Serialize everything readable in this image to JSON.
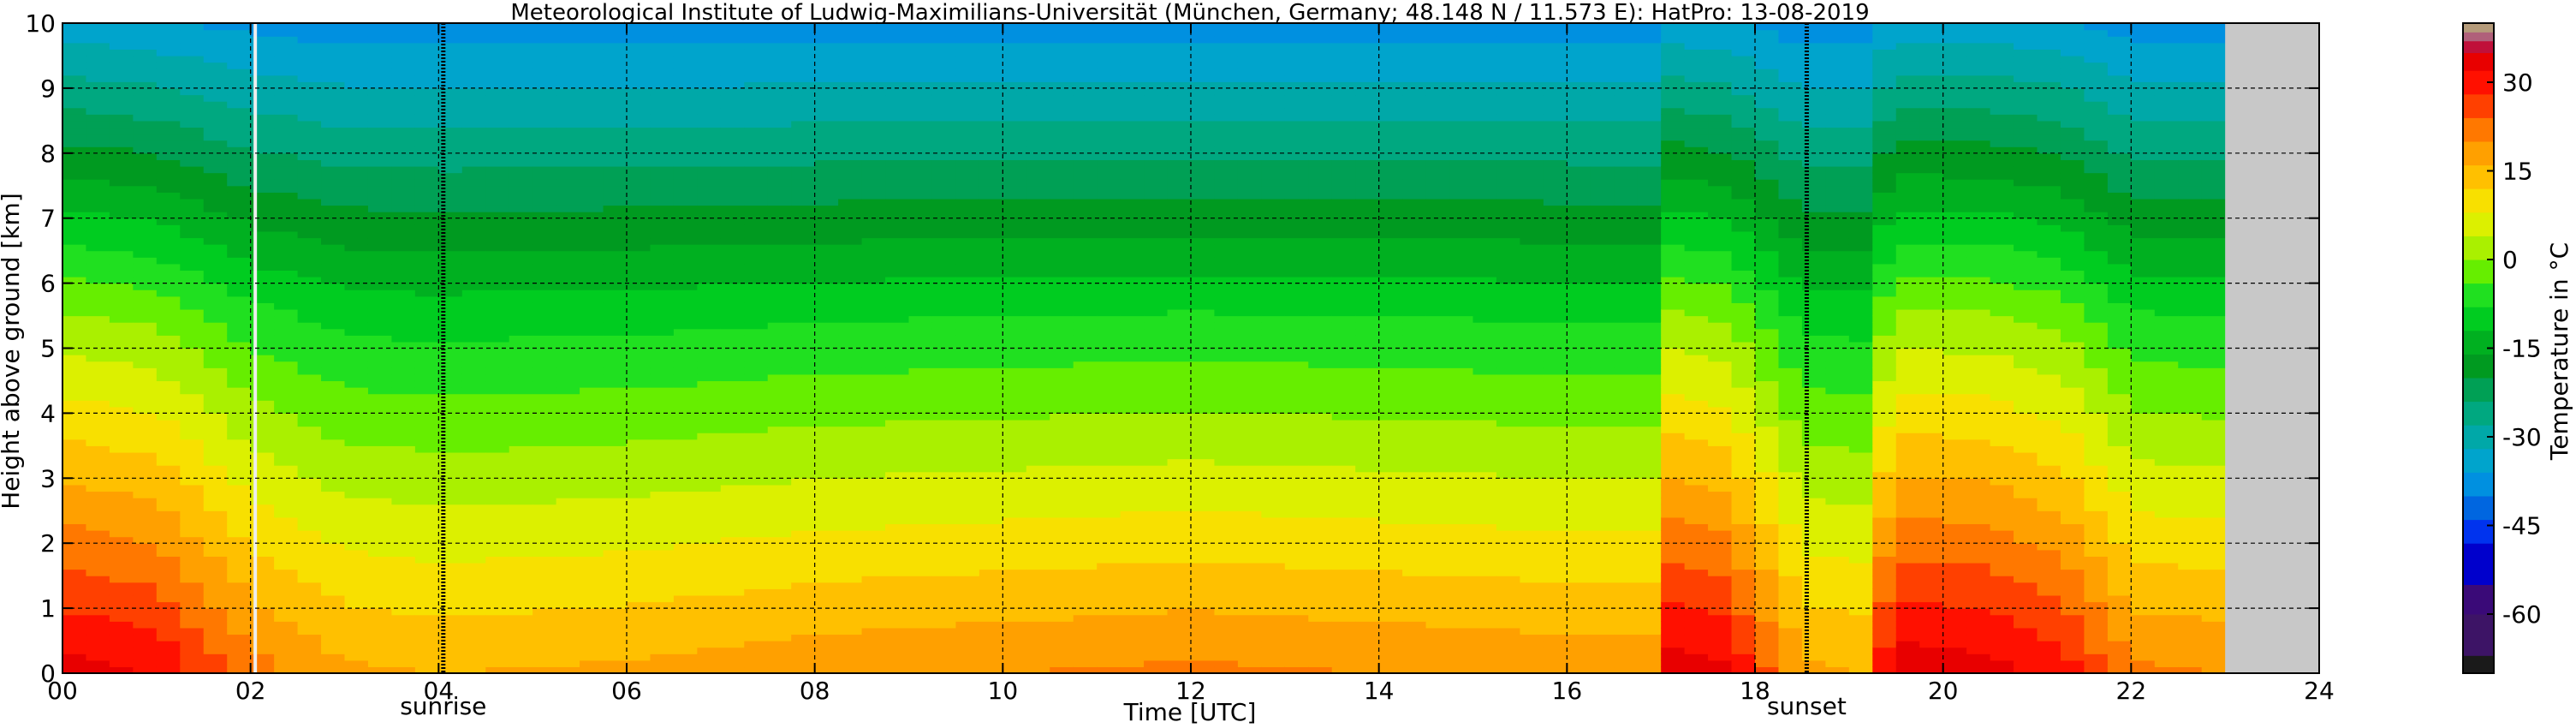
{
  "chart_data": {
    "type": "heatmap",
    "title": "Meteorological Institute of Ludwig-Maximilians-Universität (München, Germany; 48.148 N / 11.573 E):    HatPro: 13-08-2019",
    "xlabel": "Time [UTC]",
    "ylabel": "Height above ground [km]",
    "xlim": [
      0,
      24
    ],
    "ylim": [
      0,
      10
    ],
    "x_ticks": [
      {
        "value": 0,
        "label": "00"
      },
      {
        "value": 2,
        "label": "02"
      },
      {
        "value": 4,
        "label": "04"
      },
      {
        "value": 6,
        "label": "06"
      },
      {
        "value": 8,
        "label": "08"
      },
      {
        "value": 10,
        "label": "10"
      },
      {
        "value": 12,
        "label": "12"
      },
      {
        "value": 14,
        "label": "14"
      },
      {
        "value": 16,
        "label": "16"
      },
      {
        "value": 18,
        "label": "18"
      },
      {
        "value": 20,
        "label": "20"
      },
      {
        "value": 22,
        "label": "22"
      },
      {
        "value": 24,
        "label": "24"
      }
    ],
    "y_ticks": [
      {
        "value": 0,
        "label": "0"
      },
      {
        "value": 1,
        "label": "1"
      },
      {
        "value": 2,
        "label": "2"
      },
      {
        "value": 3,
        "label": "3"
      },
      {
        "value": 4,
        "label": "4"
      },
      {
        "value": 5,
        "label": "5"
      },
      {
        "value": 6,
        "label": "6"
      },
      {
        "value": 7,
        "label": "7"
      },
      {
        "value": 8,
        "label": "8"
      },
      {
        "value": 9,
        "label": "9"
      },
      {
        "value": 10,
        "label": "10"
      }
    ],
    "grid": true,
    "data_end_time": 23.0,
    "markers": [
      {
        "label": "sunrise",
        "x": 4.05
      },
      {
        "label": "sunset",
        "x": 18.55
      }
    ],
    "missing_data_gaps": [
      2.05
    ],
    "profile_times": [
      0.0,
      1.0,
      2.0,
      3.0,
      4.0,
      6.0,
      8.0,
      10.0,
      12.0,
      14.0,
      16.0,
      16.9,
      17.0,
      17.7,
      18.5,
      19.3,
      19.4,
      20.5,
      21.3,
      22.0,
      23.0
    ],
    "profiles": [
      {
        "t": 0.0,
        "t_sfc": 34,
        "lapse": 6.1
      },
      {
        "t": 1.0,
        "t_sfc": 32,
        "lapse": 6.0
      },
      {
        "t": 2.0,
        "t_sfc": 22,
        "lapse": 5.2
      },
      {
        "t": 3.0,
        "t_sfc": 17,
        "lapse": 4.8
      },
      {
        "t": 4.0,
        "t_sfc": 16,
        "lapse": 4.7
      },
      {
        "t": 6.0,
        "t_sfc": 17,
        "lapse": 4.8
      },
      {
        "t": 8.0,
        "t_sfc": 19,
        "lapse": 5.0
      },
      {
        "t": 10.0,
        "t_sfc": 20,
        "lapse": 5.1
      },
      {
        "t": 12.0,
        "t_sfc": 21,
        "lapse": 5.2
      },
      {
        "t": 14.0,
        "t_sfc": 20,
        "lapse": 5.1
      },
      {
        "t": 16.0,
        "t_sfc": 19,
        "lapse": 5.0
      },
      {
        "t": 16.9,
        "t_sfc": 19,
        "lapse": 5.0
      },
      {
        "t": 17.0,
        "t_sfc": 35,
        "lapse": 6.2
      },
      {
        "t": 17.7,
        "t_sfc": 33,
        "lapse": 6.1
      },
      {
        "t": 18.5,
        "t_sfc": 17,
        "lapse": 4.8
      },
      {
        "t": 19.3,
        "t_sfc": 16,
        "lapse": 4.7
      },
      {
        "t": 19.4,
        "t_sfc": 35,
        "lapse": 6.2
      },
      {
        "t": 20.5,
        "t_sfc": 34,
        "lapse": 6.1
      },
      {
        "t": 21.3,
        "t_sfc": 30,
        "lapse": 5.8
      },
      {
        "t": 22.0,
        "t_sfc": 21,
        "lapse": 5.2
      },
      {
        "t": 23.0,
        "t_sfc": 20,
        "lapse": 5.1
      }
    ],
    "colorbar": {
      "label": "Temperature in °C",
      "range": [
        -70,
        40
      ],
      "tick_labels": [
        {
          "value": 30,
          "label": "30"
        },
        {
          "value": 15,
          "label": "15"
        },
        {
          "value": 0,
          "label": "0"
        },
        {
          "value": -15,
          "label": "-15"
        },
        {
          "value": -30,
          "label": "-30"
        },
        {
          "value": -45,
          "label": "-45"
        },
        {
          "value": -60,
          "label": "-60"
        }
      ],
      "colors": [
        {
          "from": -70,
          "to": -67,
          "color": "#1a1a1a"
        },
        {
          "from": -67,
          "to": -60,
          "color": "#3d1466"
        },
        {
          "from": -60,
          "to": -55,
          "color": "#3a0a78"
        },
        {
          "from": -55,
          "to": -48,
          "color": "#0000cc"
        },
        {
          "from": -48,
          "to": -44,
          "color": "#0033ee"
        },
        {
          "from": -44,
          "to": -40,
          "color": "#0066e0"
        },
        {
          "from": -40,
          "to": -36,
          "color": "#0090e0"
        },
        {
          "from": -36,
          "to": -32,
          "color": "#00a4cc"
        },
        {
          "from": -32,
          "to": -28,
          "color": "#00a8a8"
        },
        {
          "from": -28,
          "to": -24,
          "color": "#00a880"
        },
        {
          "from": -24,
          "to": -20,
          "color": "#00a055"
        },
        {
          "from": -20,
          "to": -16,
          "color": "#009a20"
        },
        {
          "from": -16,
          "to": -12,
          "color": "#00b020"
        },
        {
          "from": -12,
          "to": -8,
          "color": "#00cc20"
        },
        {
          "from": -8,
          "to": -4,
          "color": "#20e020"
        },
        {
          "from": -4,
          "to": 0,
          "color": "#66ee00"
        },
        {
          "from": 0,
          "to": 4,
          "color": "#aaf000"
        },
        {
          "from": 4,
          "to": 8,
          "color": "#dcf000"
        },
        {
          "from": 8,
          "to": 12,
          "color": "#f8e000"
        },
        {
          "from": 12,
          "to": 16,
          "color": "#ffc000"
        },
        {
          "from": 16,
          "to": 20,
          "color": "#ffa000"
        },
        {
          "from": 20,
          "to": 24,
          "color": "#ff7800"
        },
        {
          "from": 24,
          "to": 28,
          "color": "#ff4000"
        },
        {
          "from": 28,
          "to": 32,
          "color": "#ff1000"
        },
        {
          "from": 32,
          "to": 35,
          "color": "#e80000"
        },
        {
          "from": 35,
          "to": 37,
          "color": "#c0103a"
        },
        {
          "from": 37,
          "to": 38.5,
          "color": "#b0607a"
        },
        {
          "from": 38.5,
          "to": 40,
          "color": "#b59b7a"
        }
      ]
    },
    "no_data_color": "#c8c8c8"
  }
}
